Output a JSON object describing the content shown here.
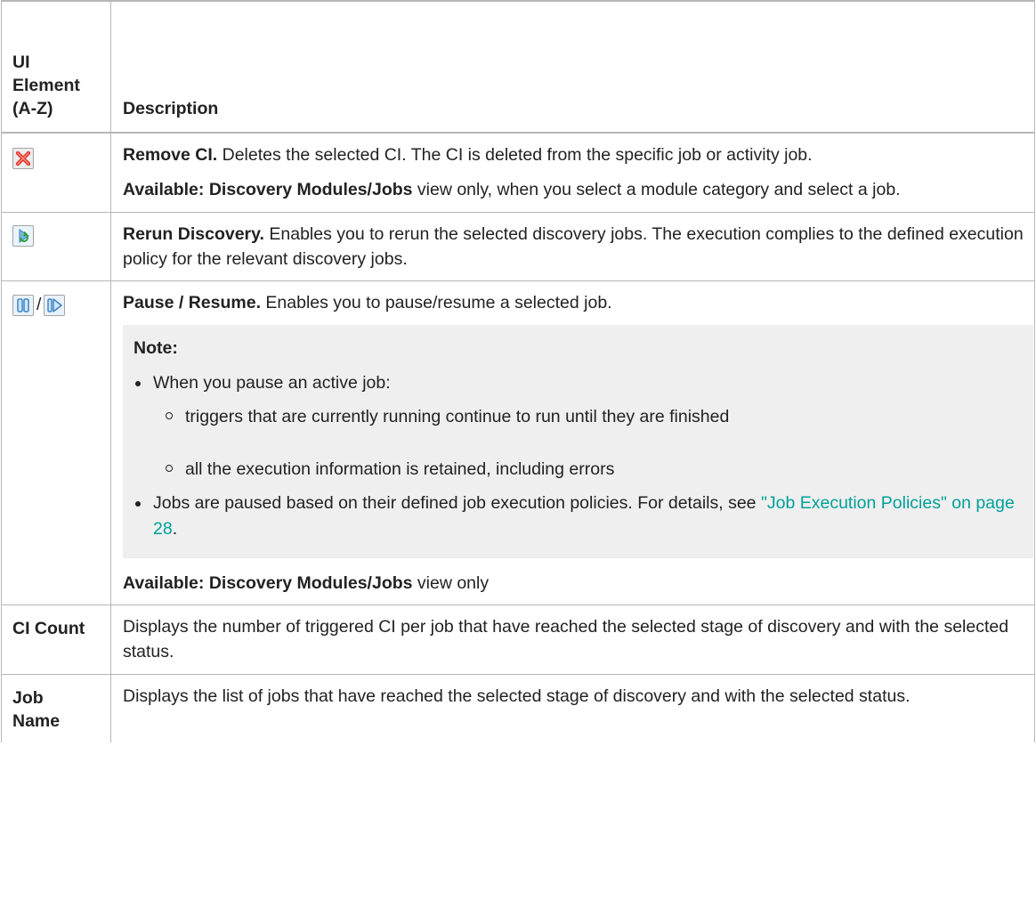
{
  "table": {
    "header": {
      "col1": [
        "UI",
        "Element",
        "(A-Z)"
      ],
      "col2": "Description"
    },
    "rows": [
      {
        "element_icon": "remove-ci-icon",
        "desc_bold": "Remove CI.",
        "desc_text": " Deletes the selected CI. The CI is deleted from the specific job or activity job.",
        "avail_label": "Available:",
        "avail_bold": " Discovery Modules/Jobs",
        "avail_text": " view only, when you select a module category and select a job."
      },
      {
        "element_icon": "rerun-discovery-icon",
        "desc_bold": "Rerun Discovery.",
        "desc_text": " Enables you to rerun the selected discovery jobs. The execution complies to the defined execution policy for the relevant discovery jobs."
      },
      {
        "element_icons": [
          "pause-icon",
          "resume-icon"
        ],
        "separator": "/",
        "desc_bold": "Pause / Resume.",
        "desc_text": " Enables you to pause/resume a selected job.",
        "note": {
          "title": "Note:",
          "item1": "When you pause an active job:",
          "sub1": "triggers that are currently running continue to run until they are finished",
          "sub2": "all the execution information is retained, including errors",
          "item2_text": "Jobs are paused based on their defined job execution policies. For details, see ",
          "item2_link": "\"Job Execution Policies\" on page 28",
          "item2_end": "."
        },
        "avail_label": "Available:",
        "avail_bold": " Discovery Modules/Jobs",
        "avail_text": " view only"
      },
      {
        "element_text": "CI Count",
        "desc_text": "Displays the number of triggered CI per job that have reached the selected stage of discovery and with the selected status."
      },
      {
        "element_text_lines": [
          "Job",
          "Name"
        ],
        "desc_text": "Displays the list of jobs that have reached the selected stage of discovery and with the selected status."
      }
    ]
  },
  "colors": {
    "link": "#00a19a",
    "note_background": "#efefef",
    "border": "#b7b7b7"
  }
}
